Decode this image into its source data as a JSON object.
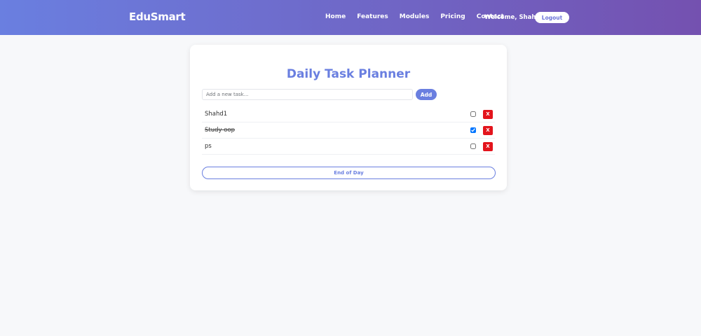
{
  "navbar": {
    "brand": "EduSmart",
    "links": [
      "Home",
      "Features",
      "Modules",
      "Pricing",
      "Contact"
    ],
    "welcome": "Welcome, Shahd",
    "logout_label": "Logout"
  },
  "planner": {
    "title": "Daily Task Planner",
    "input_placeholder": "Add a new task...",
    "input_value": "",
    "add_label": "Add",
    "tasks": [
      {
        "text": "Shahd1",
        "done": false,
        "delete_label": "X"
      },
      {
        "text": "Study oop",
        "done": true,
        "delete_label": "X"
      },
      {
        "text": "ps",
        "done": false,
        "delete_label": "X"
      }
    ],
    "end_label": "End of Day"
  },
  "colors": {
    "gradient_start": "#6a7fe0",
    "gradient_end": "#7451b0",
    "accent": "#6a7fe0",
    "danger": "#e3141c",
    "background": "#f7f8fa"
  }
}
